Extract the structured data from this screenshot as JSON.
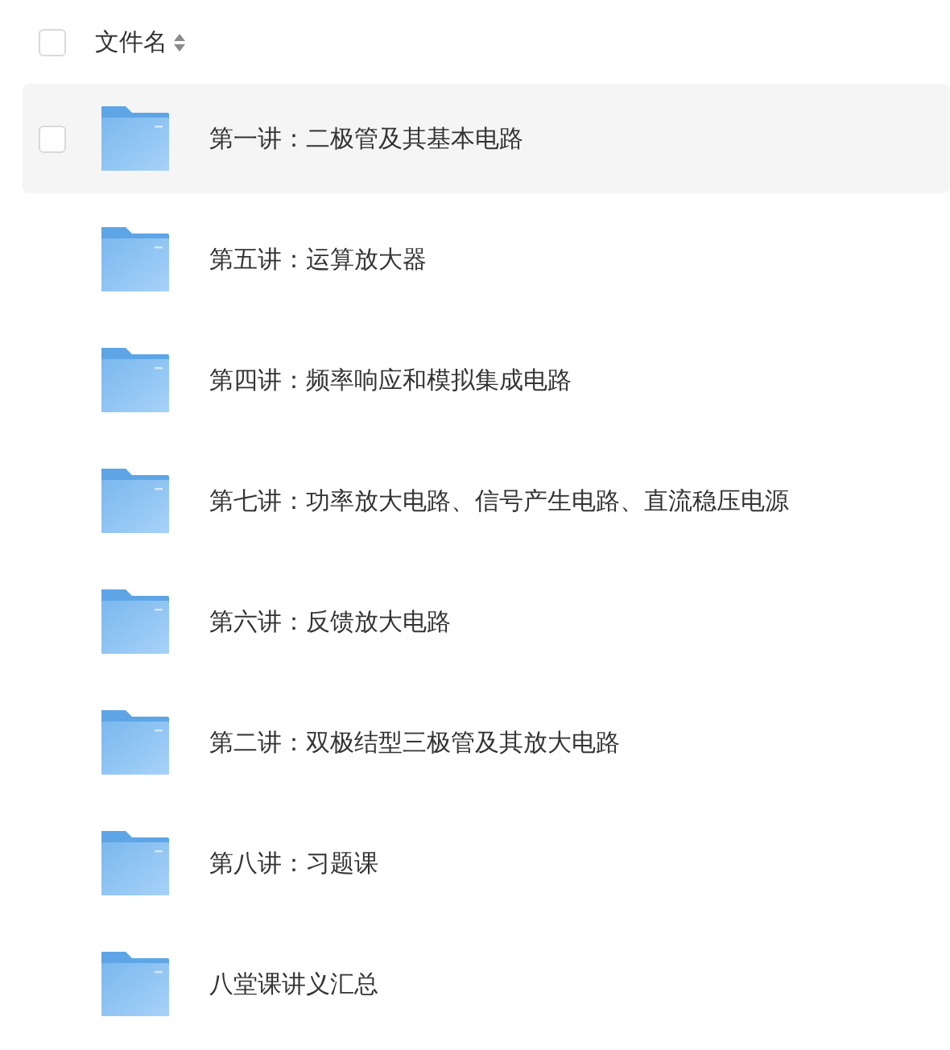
{
  "header": {
    "label": "文件名",
    "checked": false
  },
  "rows": [
    {
      "name": "第一讲：二极管及其基本电路",
      "hovered": true
    },
    {
      "name": "第五讲：运算放大器",
      "hovered": false
    },
    {
      "name": "第四讲：频率响应和模拟集成电路",
      "hovered": false
    },
    {
      "name": "第七讲：功率放大电路、信号产生电路、直流稳压电源",
      "hovered": false
    },
    {
      "name": "第六讲：反馈放大电路",
      "hovered": false
    },
    {
      "name": "第二讲：双极结型三极管及其放大电路",
      "hovered": false
    },
    {
      "name": "第八讲：习题课",
      "hovered": false
    },
    {
      "name": "八堂课讲义汇总",
      "hovered": false
    }
  ]
}
